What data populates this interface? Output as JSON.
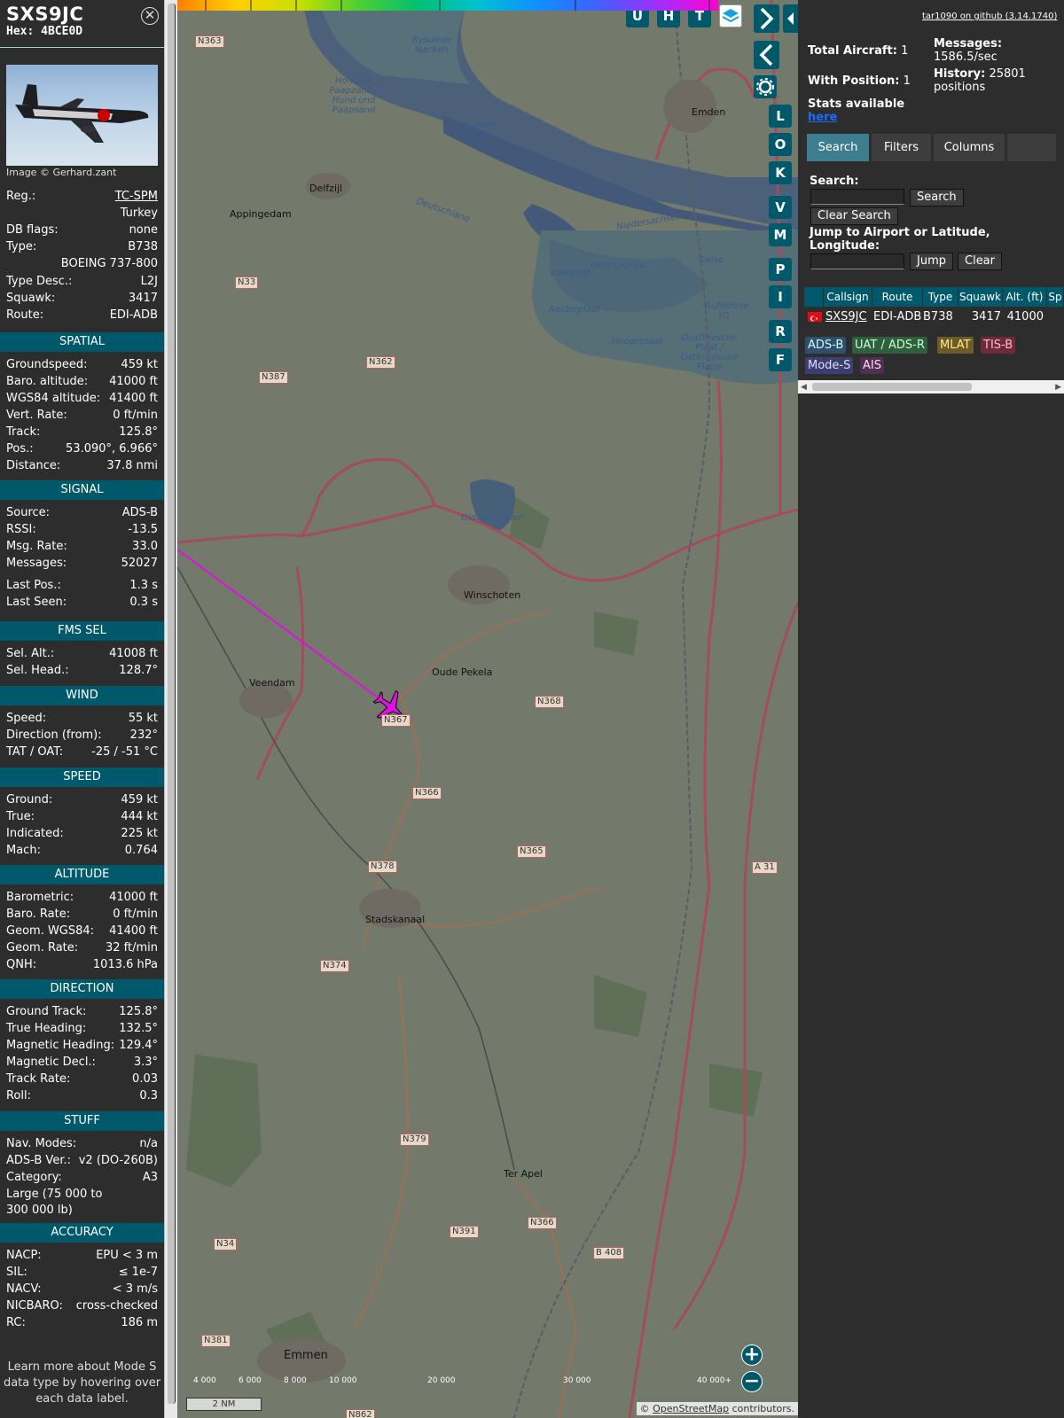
{
  "info": {
    "callsign": "SXS9JC",
    "hex_label": "Hex:",
    "hex": "4BCE0D",
    "image_credit": "Image © Gerhard.zant",
    "details": [
      {
        "k": "Reg.:",
        "v": "TC-SPM"
      },
      {
        "k": "",
        "v": "Turkey"
      },
      {
        "k": "DB flags:",
        "v": "none"
      },
      {
        "k": "Type:",
        "v": "B738"
      },
      {
        "k": "",
        "v": "BOEING 737-800"
      },
      {
        "k": "Type Desc.:",
        "v": "L2J"
      },
      {
        "k": "Squawk:",
        "v": "3417"
      },
      {
        "k": "Route:",
        "v": "EDI-ADB"
      }
    ],
    "sections": [
      {
        "title": "SPATIAL",
        "rows": [
          {
            "k": "Groundspeed:",
            "v": "459 kt"
          },
          {
            "k": "Baro. altitude:",
            "v": "41000 ft"
          },
          {
            "k": "WGS84 altitude:",
            "v": "41400 ft"
          },
          {
            "k": "Vert. Rate:",
            "v": "0 ft/min"
          },
          {
            "k": "Track:",
            "v": "125.8°"
          },
          {
            "k": "Pos.:",
            "v": "53.090°, 6.966°"
          },
          {
            "k": "Distance:",
            "v": "37.8 nmi"
          }
        ]
      },
      {
        "title": "SIGNAL",
        "rows": [
          {
            "k": "Source:",
            "v": "ADS-B"
          },
          {
            "k": "RSSI:",
            "v": "-13.5"
          },
          {
            "k": "Msg. Rate:",
            "v": "33.0"
          },
          {
            "k": "Messages:",
            "v": "52027"
          },
          {
            "k": "Last Pos.:",
            "v": "1.3 s"
          },
          {
            "k": "Last Seen:",
            "v": "0.3 s"
          }
        ]
      },
      {
        "title": "FMS SEL",
        "rows": [
          {
            "k": "Sel. Alt.:",
            "v": "41008 ft"
          },
          {
            "k": "Sel. Head.:",
            "v": "128.7°"
          }
        ]
      },
      {
        "title": "WIND",
        "rows": [
          {
            "k": "Speed:",
            "v": "55 kt"
          },
          {
            "k": "Direction (from):",
            "v": "232°"
          },
          {
            "k": "TAT / OAT:",
            "v": "-25 / -51 °C"
          }
        ]
      },
      {
        "title": "SPEED",
        "rows": [
          {
            "k": "Ground:",
            "v": "459 kt"
          },
          {
            "k": "True:",
            "v": "444 kt"
          },
          {
            "k": "Indicated:",
            "v": "225 kt"
          },
          {
            "k": "Mach:",
            "v": "0.764"
          }
        ]
      },
      {
        "title": "ALTITUDE",
        "rows": [
          {
            "k": "Barometric:",
            "v": "41000 ft"
          },
          {
            "k": "Baro. Rate:",
            "v": "0 ft/min"
          },
          {
            "k": "Geom. WGS84:",
            "v": "41400 ft"
          },
          {
            "k": "Geom. Rate:",
            "v": "32 ft/min"
          },
          {
            "k": "QNH:",
            "v": "1013.6 hPa"
          }
        ]
      },
      {
        "title": "DIRECTION",
        "rows": [
          {
            "k": "Ground Track:",
            "v": "125.8°"
          },
          {
            "k": "True Heading:",
            "v": "132.5°"
          },
          {
            "k": "Magnetic Heading:",
            "v": "129.4°"
          },
          {
            "k": "Magnetic Decl.:",
            "v": "3.3°"
          },
          {
            "k": "Track Rate:",
            "v": "0.03"
          },
          {
            "k": "Roll:",
            "v": "0.3"
          }
        ]
      },
      {
        "title": "STUFF",
        "rows": [
          {
            "k": "Nav. Modes:",
            "v": "n/a"
          },
          {
            "k": "ADS-B Ver.:",
            "v": "v2 (DO-260B)"
          },
          {
            "k": "Category:",
            "v": "A3"
          },
          {
            "k": "Large (75 000 to",
            "v": ""
          },
          {
            "k": "300 000 lb)",
            "v": ""
          }
        ]
      },
      {
        "title": "ACCURACY",
        "rows": [
          {
            "k": "NACP:",
            "v": "EPU < 3 m"
          },
          {
            "k": "SIL:",
            "v": "≤ 1e-7"
          },
          {
            "k": "NACV:",
            "v": "< 3 m/s"
          },
          {
            "k": "NICBARO:",
            "v": "cross-checked"
          },
          {
            "k": "RC:",
            "v": "186 m"
          }
        ]
      }
    ],
    "learn_more": "Learn more about Mode S data type by hovering over each data label."
  },
  "map": {
    "top_buttons": [
      "U",
      "H",
      "T"
    ],
    "side_buttons": [
      "L",
      "O",
      "K",
      "V",
      "M",
      "P",
      "I",
      "R",
      "F"
    ],
    "places": [
      "Delfzijl",
      "Appingedam",
      "Emden",
      "Winschoten",
      "Oude Pekela",
      "Veendam",
      "Stadskanaal",
      "Ter Apel",
      "Emmen",
      "Oldambtmeer"
    ],
    "road_labels": [
      "N363",
      "N33",
      "N387",
      "N362",
      "N368",
      "N366",
      "N378",
      "N365",
      "N374",
      "N379",
      "N391",
      "N34",
      "N381",
      "N366",
      "B 408",
      "A 31",
      "N862",
      "N367"
    ],
    "water_labels": [
      "Rysumer Nacken",
      "Hond en Paapzand / Hund und Paapsand",
      "Rysumer Nacken",
      "Deutschland",
      "Niedersachsen",
      "Geise",
      "Heringsplaat",
      "Kerkeriet",
      "Reiderplaat",
      "Hoogeplaat",
      "Ruhezone I/1",
      "Oostfriesche Plaat / Ostfriesische Platte"
    ],
    "altitude_scale": [
      "4 000",
      "6 000",
      "8 000",
      "10 000",
      "20 000",
      "30 000",
      "40 000+"
    ],
    "altitude_colors": [
      "#ff8000",
      "#ffd000",
      "#c8e000",
      "#50d030",
      "#00c070",
      "#00c0d0",
      "#1090ff",
      "#4060ff",
      "#a030ff",
      "#ff00d0"
    ],
    "scale_label": "2 NM",
    "attribution_prefix": "© ",
    "attribution_link": "OpenStreetMap",
    "attribution_suffix": " contributors.",
    "zoom_in": "+",
    "zoom_out": "−"
  },
  "stats": {
    "github_link": "tar1090 on github (3.14.1740)",
    "total_label": "Total Aircraft:",
    "total": "1",
    "with_pos_label": "With Position:",
    "with_pos": "1",
    "stats_available": "Stats available",
    "here": "here",
    "messages_label": "Messages:",
    "messages": "1586.5/sec",
    "history_label": "History:",
    "history_value": "25801",
    "history_unit": "positions"
  },
  "tabs": [
    "Search",
    "Filters",
    "Columns"
  ],
  "search": {
    "search_label": "Search:",
    "search_button": "Search",
    "clear_search": "Clear Search",
    "jump_label_1": "Jump to Airport or Latitude,",
    "jump_label_2": "Longitude:",
    "jump_button": "Jump",
    "clear_button": "Clear"
  },
  "table": {
    "headers": [
      "",
      "Callsign",
      "Route",
      "Type",
      "Squawk",
      "Alt. (ft)",
      "Sp"
    ],
    "rows": [
      {
        "callsign": "SXS9JC",
        "route": "EDI-ADB",
        "type": "B738",
        "squawk": "3417",
        "alt": "41000"
      }
    ]
  },
  "legend": [
    {
      "label": "ADS-B",
      "bg": "#2f4f6f",
      "fg": "#cfe"
    },
    {
      "label": "UAT / ADS-R",
      "bg": "#2f5f3f",
      "fg": "#cfc"
    },
    {
      "label": "MLAT",
      "bg": "#6f5a2a",
      "fg": "#fe8"
    },
    {
      "label": "TIS-B",
      "bg": "#6f2a3a",
      "fg": "#fbc"
    },
    {
      "label": "Mode-S",
      "bg": "#3f3f6f",
      "fg": "#ddf"
    },
    {
      "label": "AIS",
      "bg": "#4f2f4f",
      "fg": "#fdf"
    }
  ]
}
